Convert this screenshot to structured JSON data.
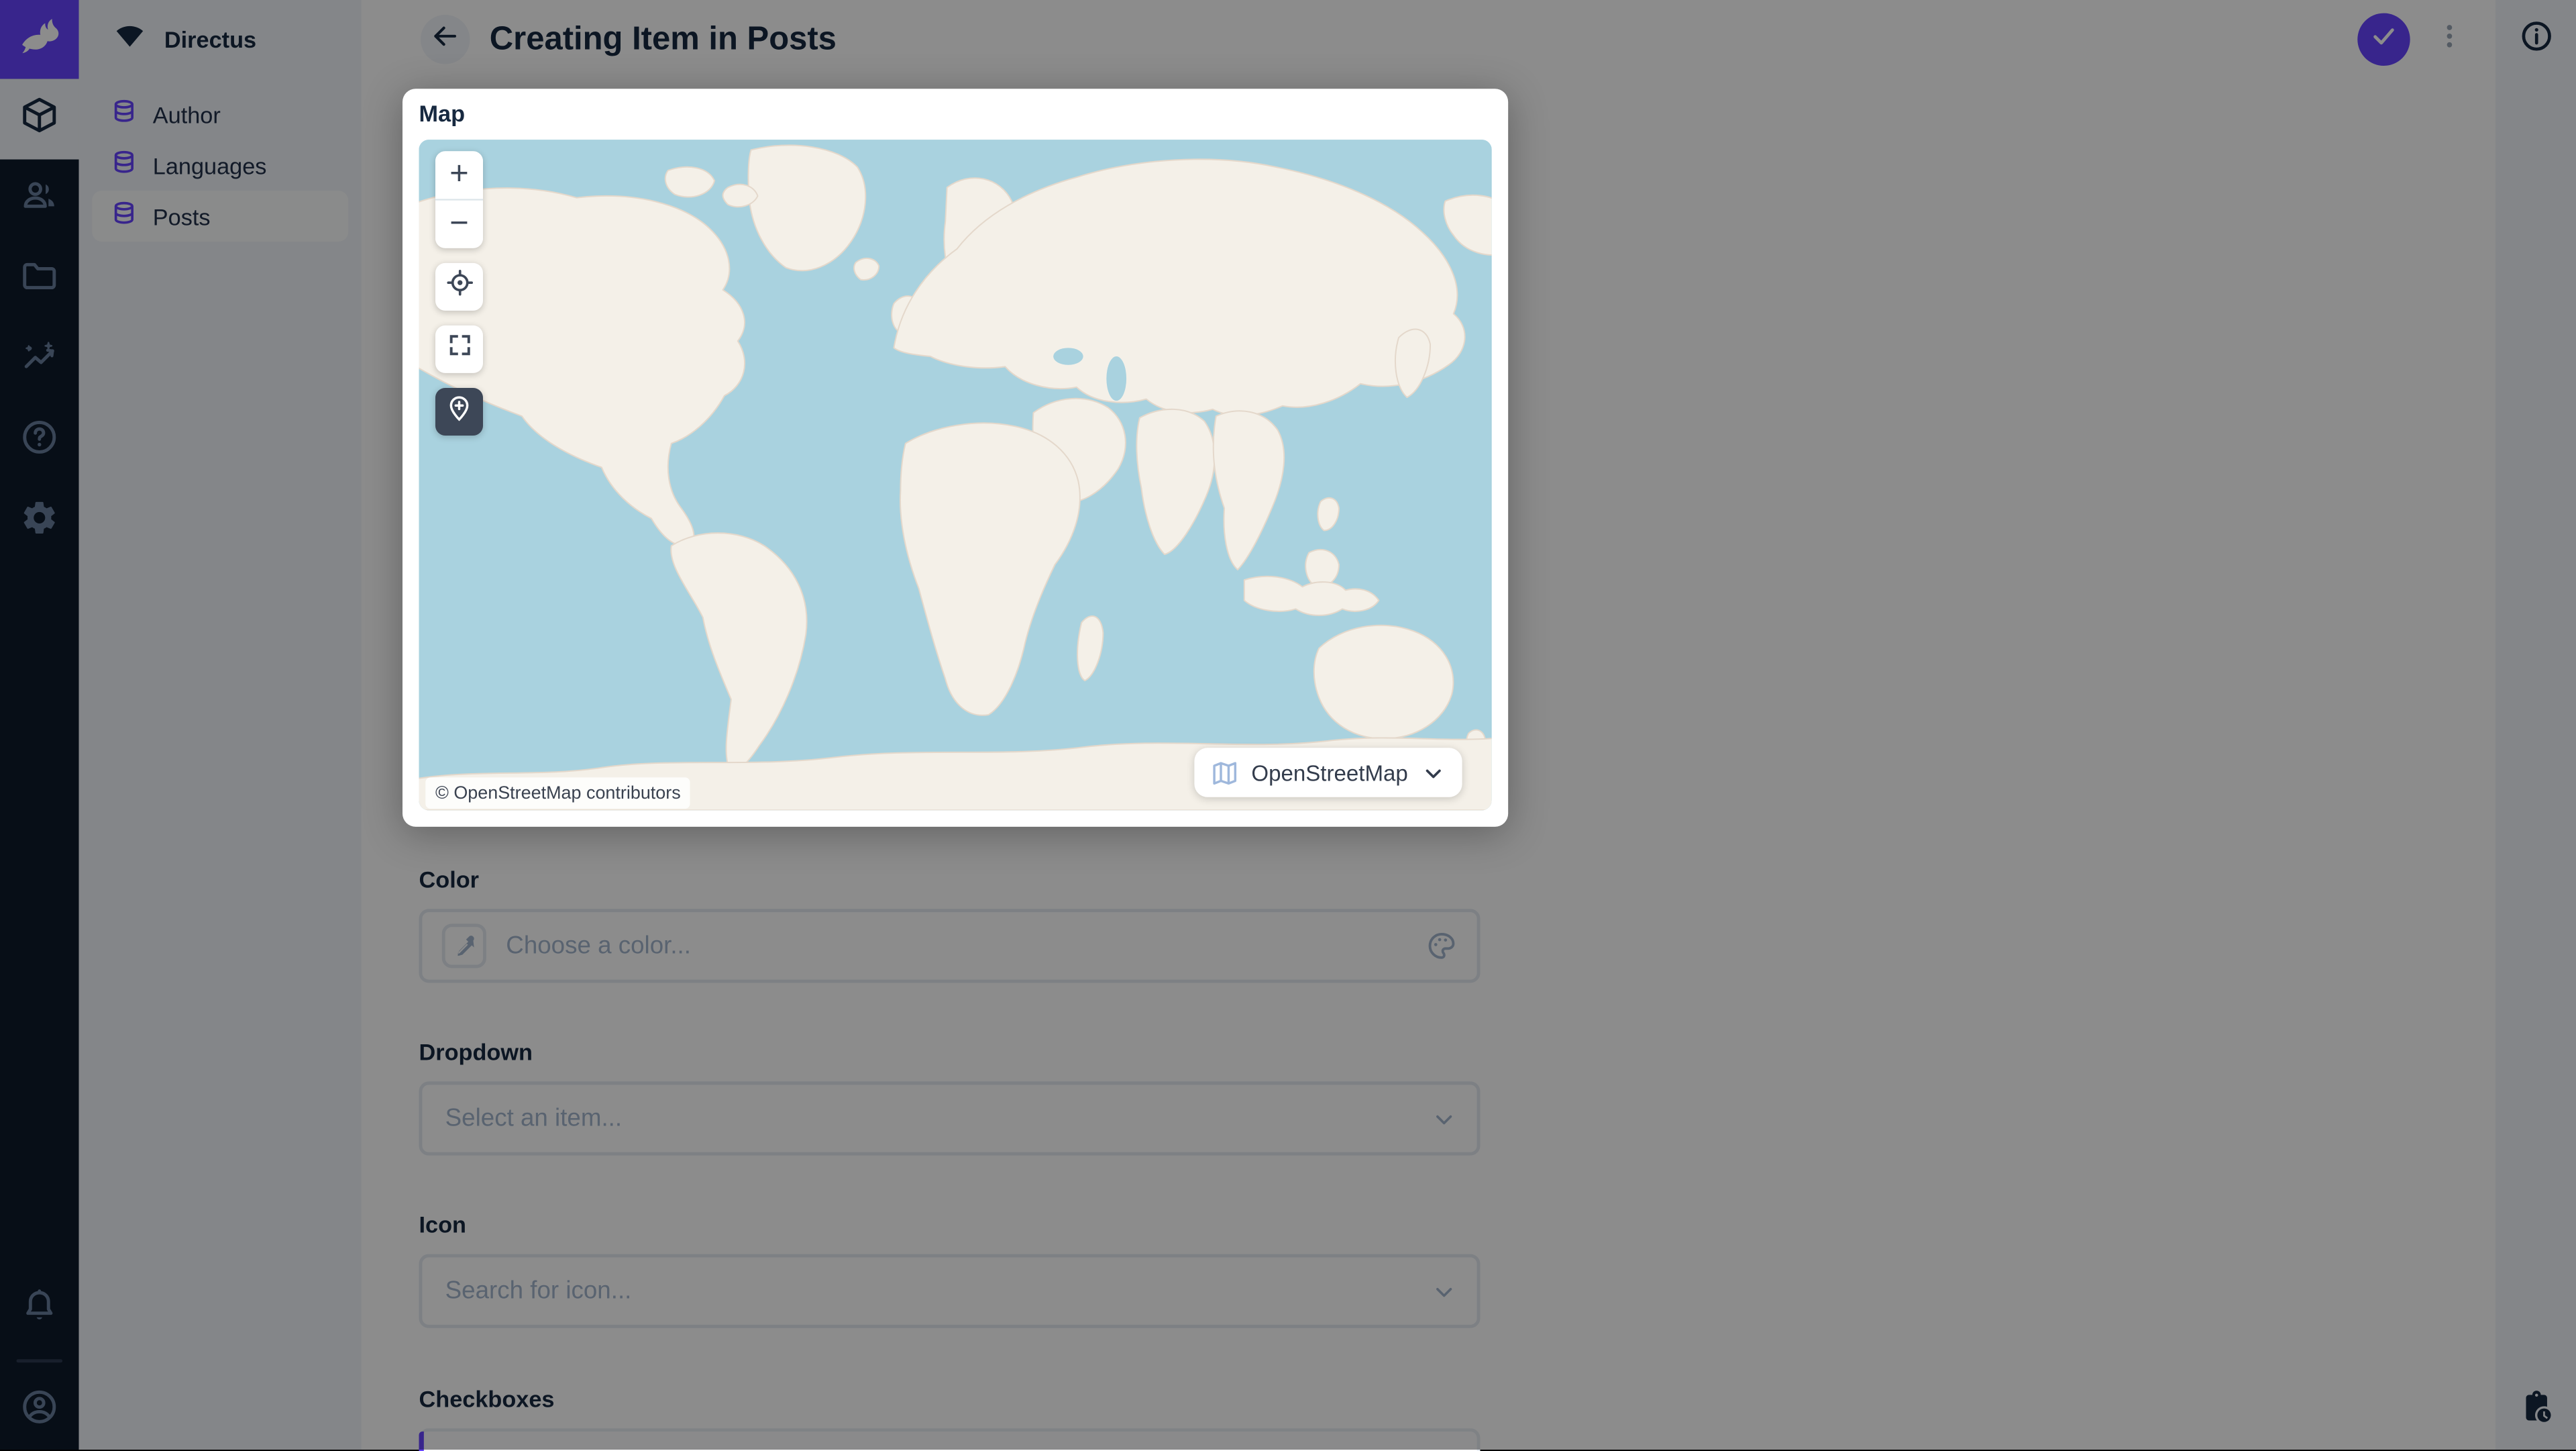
{
  "colors": {
    "accent": "#6644ff",
    "module_bar_bg": "#0e1a2b",
    "foreground": "#172940",
    "subdued_text": "#a2b5cd",
    "map_water": "#a9d2df",
    "map_land": "#f4f0e8"
  },
  "module_bar": {
    "modules": [
      "content",
      "user-directory",
      "file-library",
      "insights",
      "documentation",
      "settings"
    ],
    "active_module": "content",
    "bottom": [
      "notifications",
      "user-menu"
    ]
  },
  "nav": {
    "project_name": "Directus",
    "items": [
      {
        "label": "Author",
        "active": false
      },
      {
        "label": "Languages",
        "active": false
      },
      {
        "label": "Posts",
        "active": true
      }
    ]
  },
  "header": {
    "title": "Creating Item in Posts",
    "actions": [
      "save",
      "more-options"
    ]
  },
  "right_sidebar": {
    "icons": [
      "info",
      "revisions"
    ]
  },
  "map_card": {
    "label": "Map",
    "zoom_in_label": "+",
    "zoom_out_label": "−",
    "controls": [
      "zoom-in",
      "zoom-out",
      "geolocate",
      "fullscreen",
      "add-marker"
    ],
    "active_control": "add-marker",
    "attribution": "© OpenStreetMap contributors",
    "basemap": {
      "label": "OpenStreetMap"
    }
  },
  "fields": {
    "color": {
      "label": "Color",
      "placeholder": "Choose a color..."
    },
    "dropdown": {
      "label": "Dropdown",
      "placeholder": "Select an item..."
    },
    "icon": {
      "label": "Icon",
      "placeholder": "Search for icon..."
    },
    "checkboxes": {
      "label": "Checkboxes"
    }
  }
}
